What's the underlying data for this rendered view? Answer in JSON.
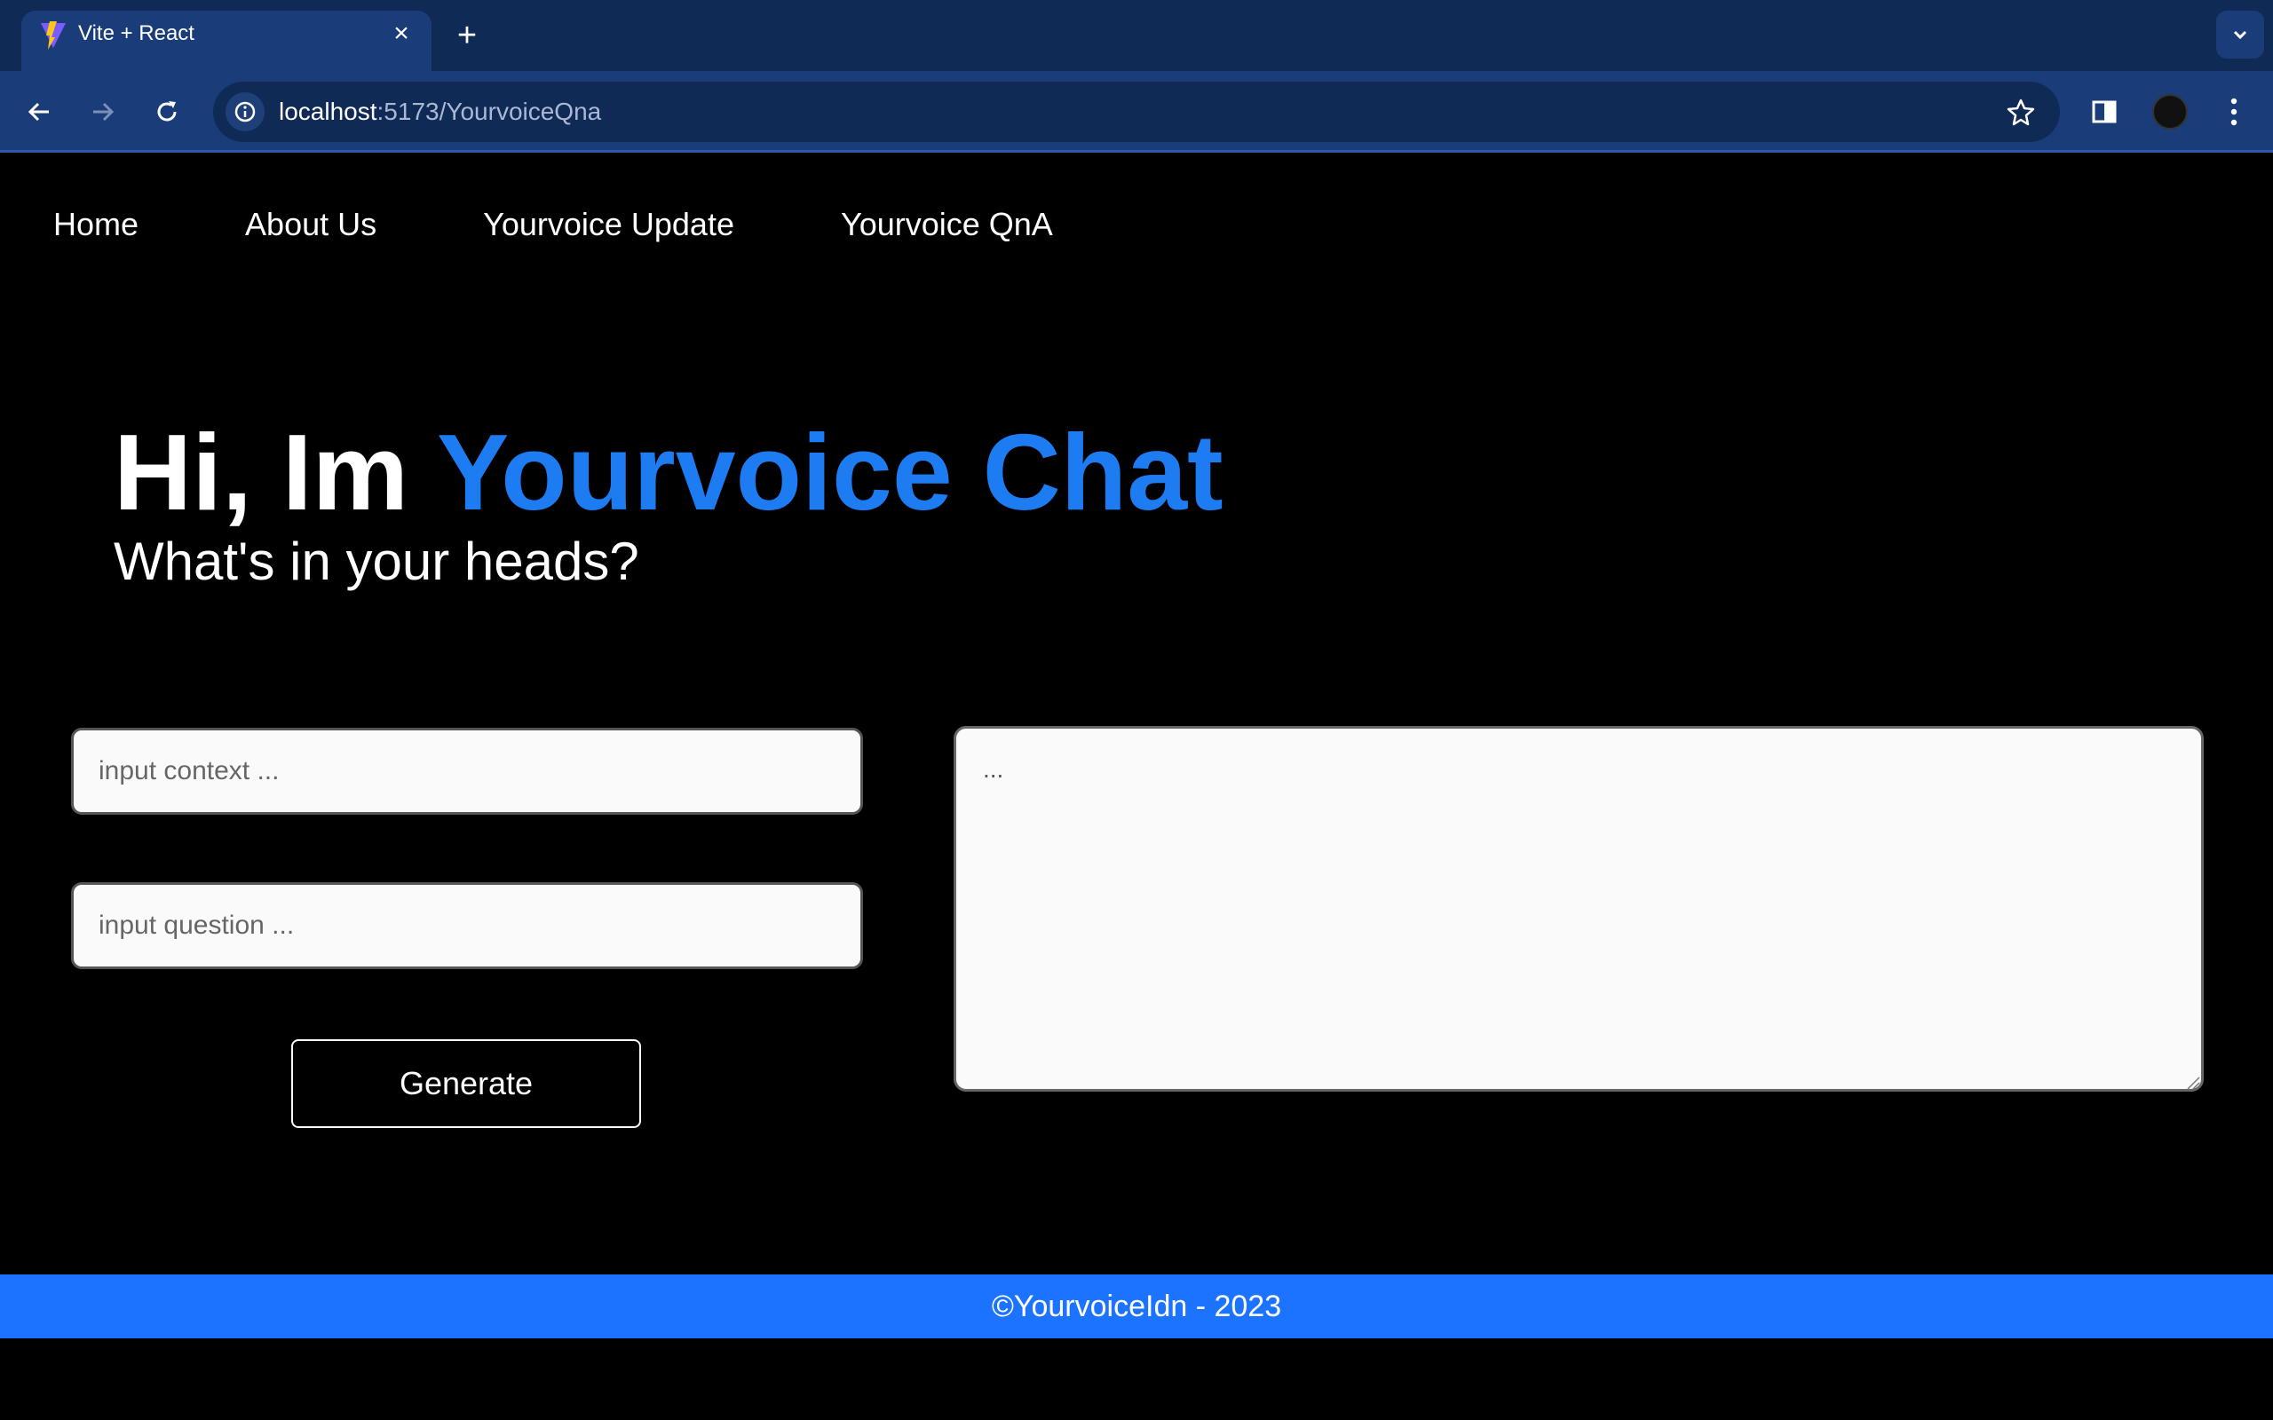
{
  "browser": {
    "tab_title": "Vite + React",
    "url_host": "localhost",
    "url_path": ":5173/YourvoiceQna",
    "icons": {
      "favicon": "vite-logo-icon",
      "close": "close-icon",
      "new_tab": "plus-icon",
      "tab_list": "chevron-down-icon",
      "back": "arrow-left-icon",
      "forward": "arrow-right-icon",
      "reload": "reload-icon",
      "site_info": "info-icon",
      "bookmark": "star-icon",
      "side_panel": "side-panel-icon",
      "menu": "kebab-menu-icon"
    }
  },
  "nav": {
    "items": [
      {
        "label": "Home"
      },
      {
        "label": "About Us"
      },
      {
        "label": "Yourvoice Update"
      },
      {
        "label": "Yourvoice QnA"
      }
    ]
  },
  "hero": {
    "title_prefix": "Hi, Im ",
    "title_accent": "Yourvoice Chat",
    "subtitle": "What's in your heads?",
    "accent_color": "#1d7cf2"
  },
  "form": {
    "context_placeholder": "input context ...",
    "question_placeholder": "input question ...",
    "generate_label": "Generate",
    "output_placeholder": "..."
  },
  "footer": {
    "text": "©YourvoiceIdn - 2023",
    "color": "#1c73ff"
  }
}
